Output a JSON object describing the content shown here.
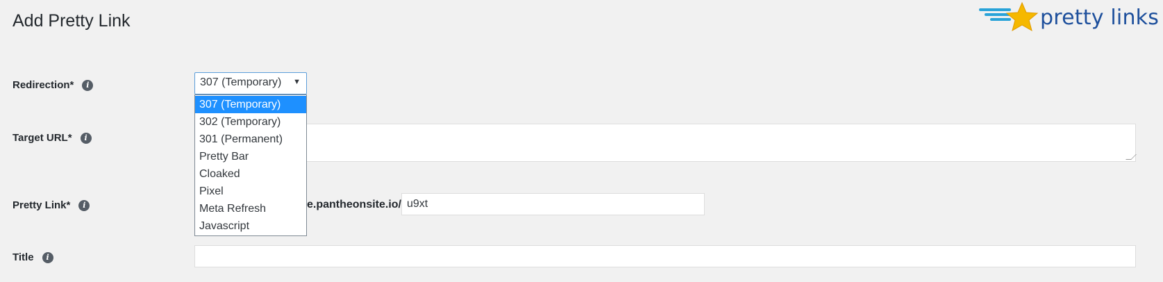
{
  "page": {
    "title": "Add Pretty Link"
  },
  "logo": {
    "text": "pretty links"
  },
  "fields": {
    "redirection": {
      "label": "Redirection*",
      "selected": "307 (Temporary)",
      "options": [
        "307 (Temporary)",
        "302 (Temporary)",
        "301 (Permanent)",
        "Pretty Bar",
        "Cloaked",
        "Pixel",
        "Meta Refresh",
        "Javascript"
      ]
    },
    "target_url": {
      "label": "Target URL*",
      "value": ""
    },
    "pretty_link": {
      "label": "Pretty Link*",
      "domain": "e.pantheonsite.io/",
      "slug": "u9xt"
    },
    "title": {
      "label": "Title",
      "value": ""
    }
  },
  "info_icon_glyph": "i",
  "colors": {
    "highlight": "#1e90ff",
    "logo_blue": "#1d4f9c",
    "star": "#f5b800"
  }
}
